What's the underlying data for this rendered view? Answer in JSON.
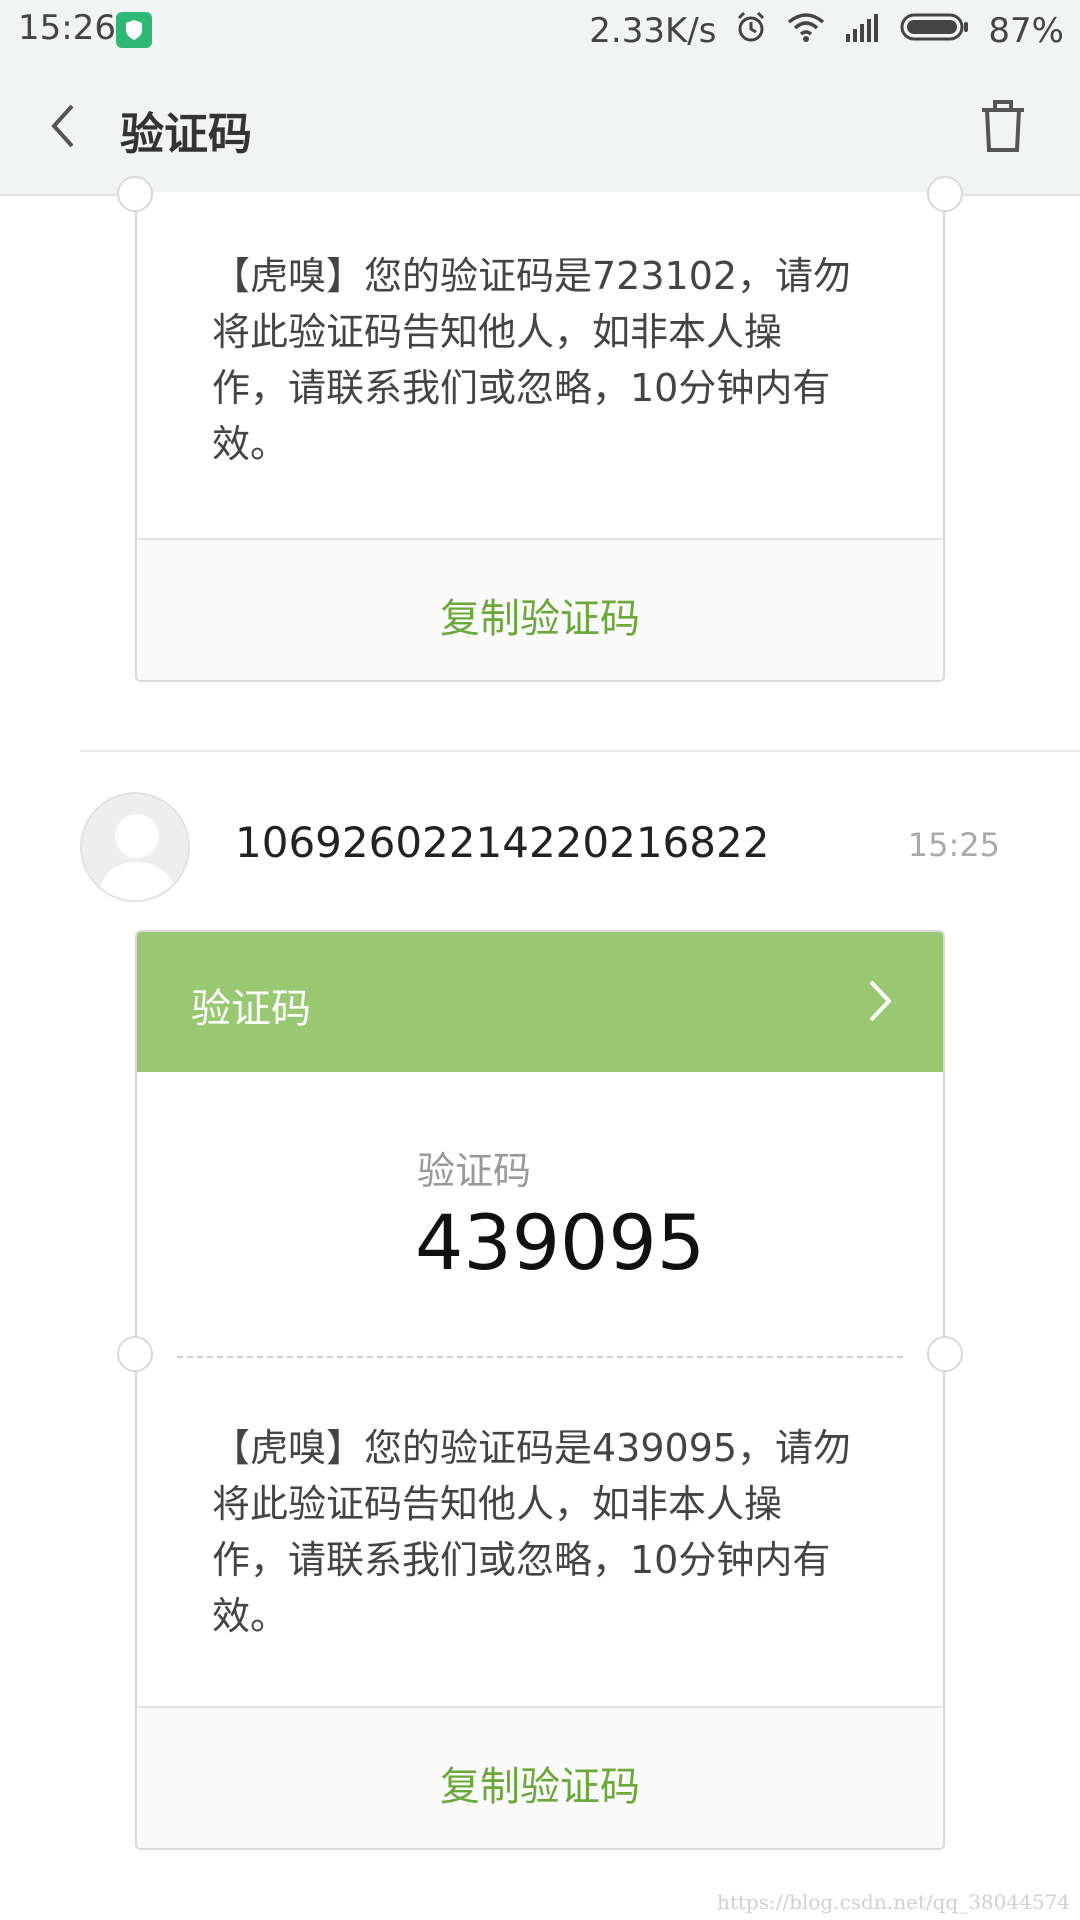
{
  "status_bar": {
    "time": "15:26",
    "net_speed": "2.33K/s",
    "battery": "87%"
  },
  "header": {
    "title": "验证码",
    "back_icon": "chevron-left-icon",
    "delete_icon": "trash-icon"
  },
  "messages": [
    {
      "text": "【虎嗅】您的验证码是723102，请勿将此验证码告知他人，如非本人操作，请联系我们或忽略，10分钟内有效。",
      "copy_label": "复制验证码"
    },
    {
      "sender": "10692602214220216822",
      "time": "15:25",
      "card_title": "验证码",
      "code_label": "验证码",
      "code": "439095",
      "text": "【虎嗅】您的验证码是439095，请勿将此验证码告知他人，如非本人操作，请联系我们或忽略，10分钟内有效。",
      "copy_label": "复制验证码"
    }
  ],
  "watermark": "https://blog.csdn.net/qq_38044574",
  "colors": {
    "accent_green": "#98c872",
    "copy_text_green": "#6aa93a"
  }
}
